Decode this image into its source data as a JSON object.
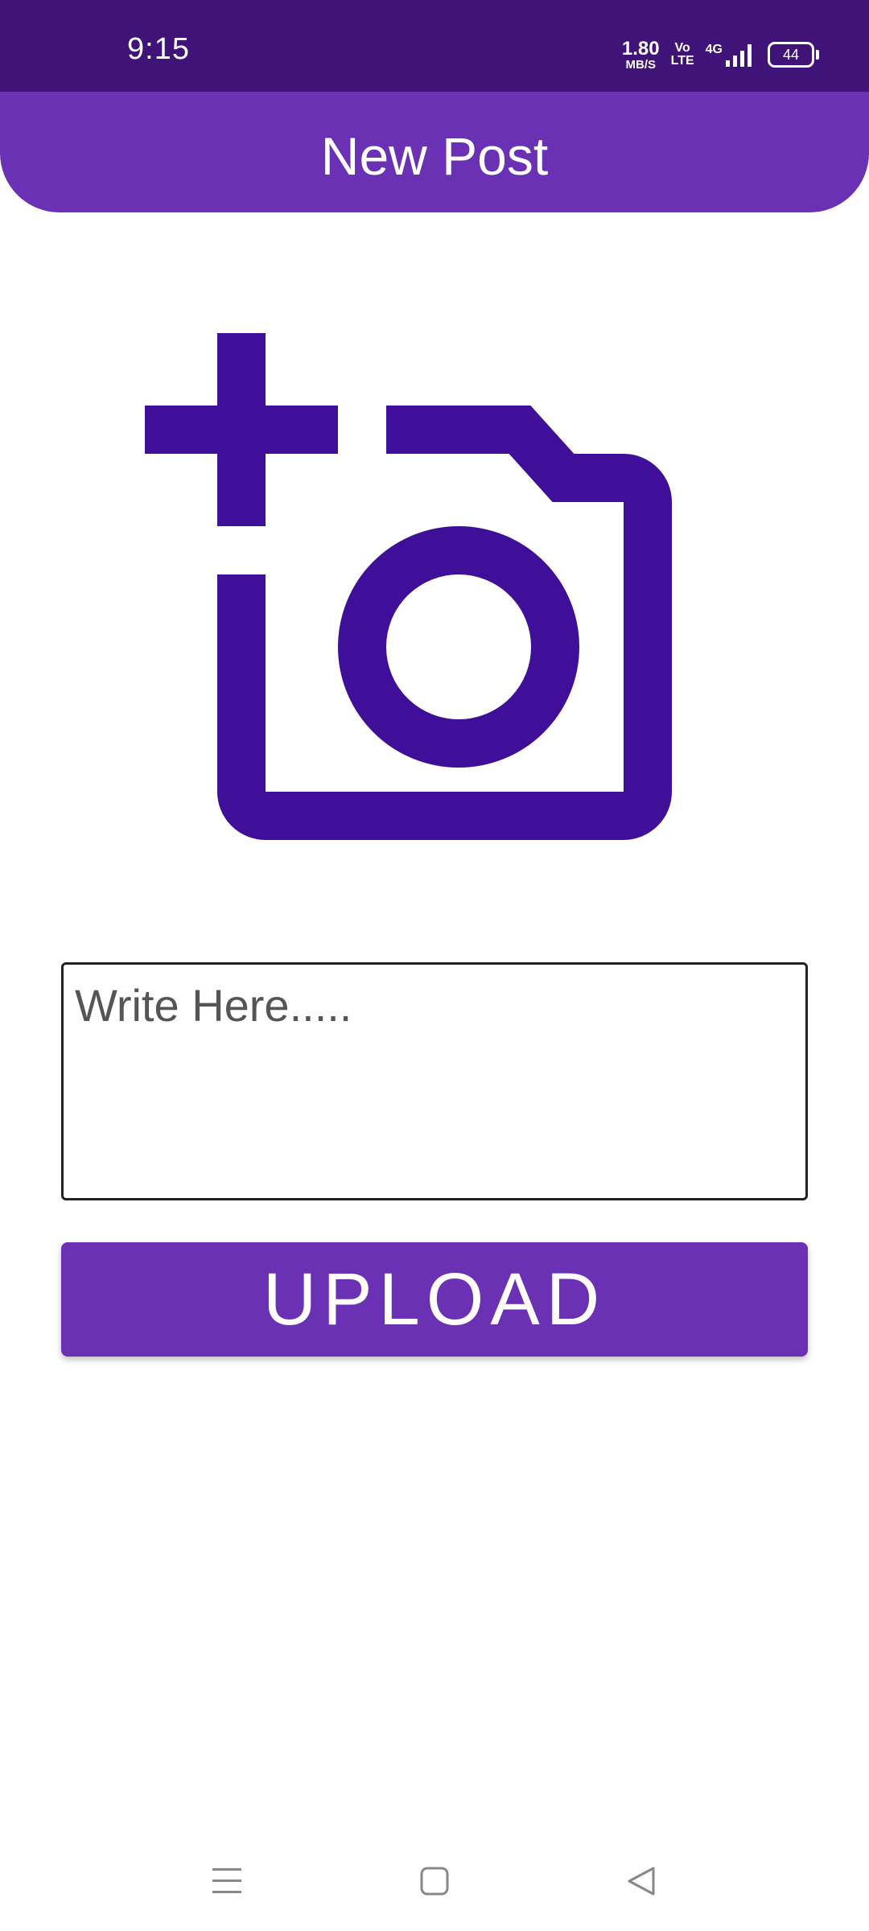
{
  "status_bar": {
    "time": "9:15",
    "net_speed_value": "1.80",
    "net_speed_unit": "MB/S",
    "volte_top": "Vo",
    "volte_bottom": "LTE",
    "network_type": "4G",
    "battery": "44"
  },
  "app_bar": {
    "title": "New Post"
  },
  "camera": {
    "icon": "add-photo-icon",
    "color": "#3f0f99"
  },
  "post_input": {
    "value": "",
    "placeholder": "Write Here....."
  },
  "upload_button": {
    "label": "UPLOAD"
  },
  "nav_bar": {
    "icons": [
      "menu-icon",
      "home-icon",
      "back-icon"
    ]
  },
  "colors": {
    "status_bar": "#3f1378",
    "primary": "#6a31b4",
    "icon": "#3f0f99"
  }
}
